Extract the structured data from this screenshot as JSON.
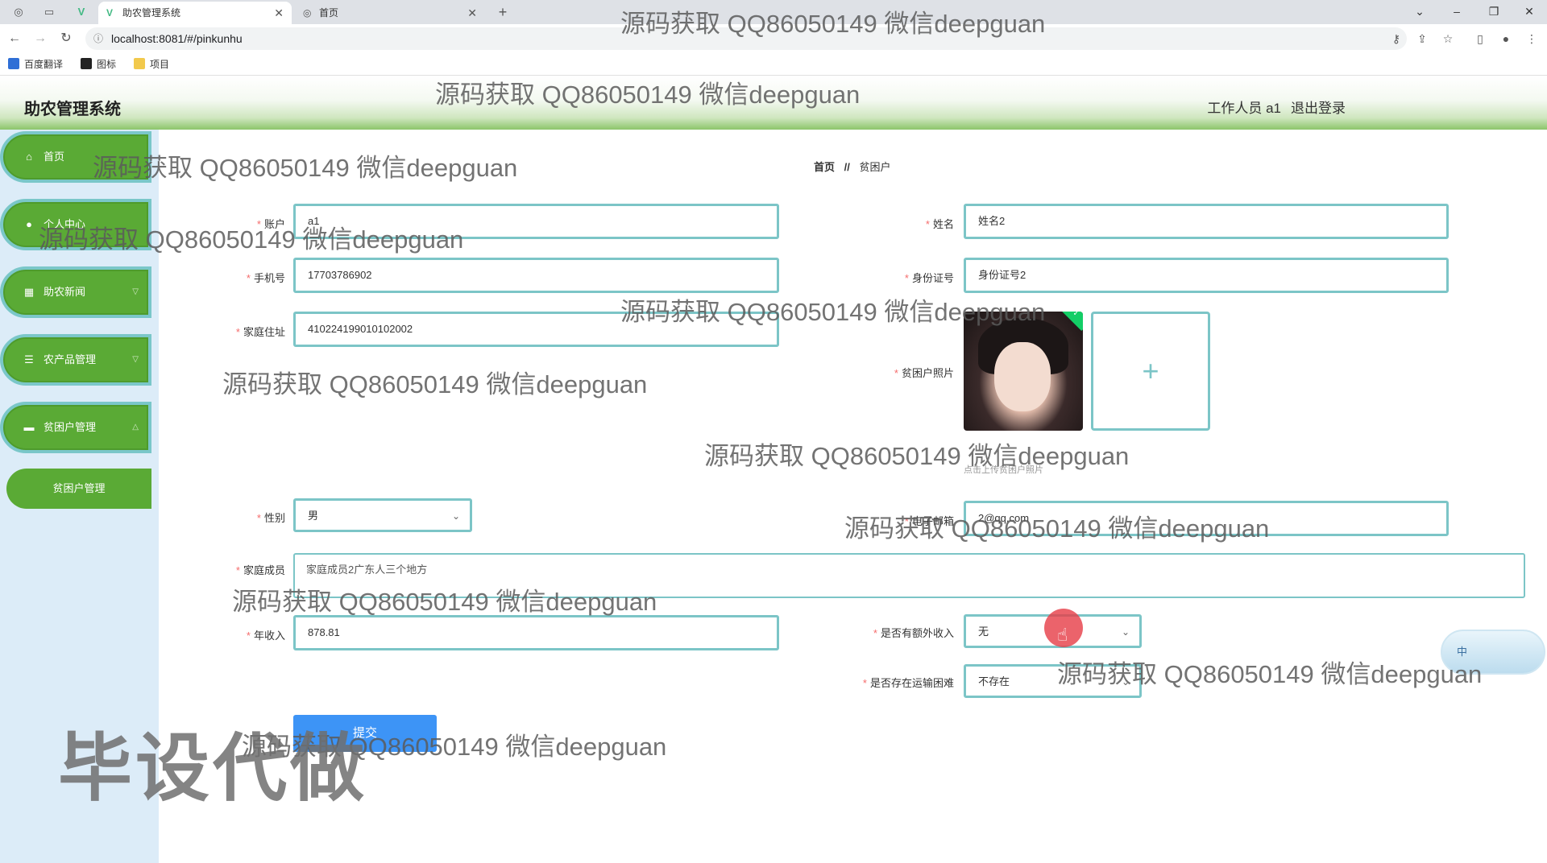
{
  "browser": {
    "tabs": [
      {
        "title": "助农管理系统",
        "active": true
      },
      {
        "title": "首页",
        "active": false
      }
    ],
    "new_tab": "+",
    "url": "localhost:8081/#/pinkunhu",
    "bookmarks": [
      {
        "label": "百度翻译",
        "color": "#2f6fd6"
      },
      {
        "label": "图标",
        "color": "#222222"
      },
      {
        "label": "项目",
        "color": "#f2c94c"
      }
    ]
  },
  "header": {
    "title": "助农管理系统",
    "user": "工作人员 a1",
    "logout": "退出登录",
    "gradient_color": "#8cc56a"
  },
  "sidebar": {
    "items": [
      {
        "label": "首页",
        "icon": "home-icon",
        "glyph": "⌂"
      },
      {
        "label": "个人中心",
        "icon": "user-icon",
        "glyph": "●"
      },
      {
        "label": "助农新闻",
        "icon": "grid-icon",
        "glyph": "▦"
      },
      {
        "label": "农产品管理",
        "icon": "list-icon",
        "glyph": "☰"
      },
      {
        "label": "贫困户管理",
        "icon": "monitor-icon",
        "glyph": "▬"
      }
    ],
    "submenu_active": "贫困户管理",
    "accent": "#5aaa35",
    "border": "#7ac7c9"
  },
  "breadcrumb": {
    "home": "首页",
    "sep": "//",
    "current": "贫困户"
  },
  "form": {
    "account": {
      "label": "账户",
      "value": "a1"
    },
    "name": {
      "label": "姓名",
      "value": "姓名2"
    },
    "phone": {
      "label": "手机号",
      "value": "17703786902"
    },
    "id_card": {
      "label": "身份证号",
      "value": "身份证号2"
    },
    "address": {
      "label": "家庭住址",
      "value": "410224199010102002"
    },
    "photo": {
      "label": "贫困户照片",
      "tip": "点击上传贫困户照片",
      "add": "+"
    },
    "gender": {
      "label": "性别",
      "value": "男"
    },
    "email": {
      "label": "电子邮箱",
      "value": "2@qq.com"
    },
    "family": {
      "label": "家庭成员",
      "value": "家庭成员2广东人三个地方"
    },
    "income": {
      "label": "年收入",
      "value": "878.81"
    },
    "extra_income": {
      "label": "是否有额外收入",
      "value": "无"
    },
    "transport": {
      "label": "是否存在运输困难",
      "value": "不存在"
    },
    "submit": "提交"
  },
  "overlay": {
    "watermark": "源码获取 QQ86050149 微信deepguan",
    "big_watermark": "毕设代做",
    "widget": "中"
  }
}
